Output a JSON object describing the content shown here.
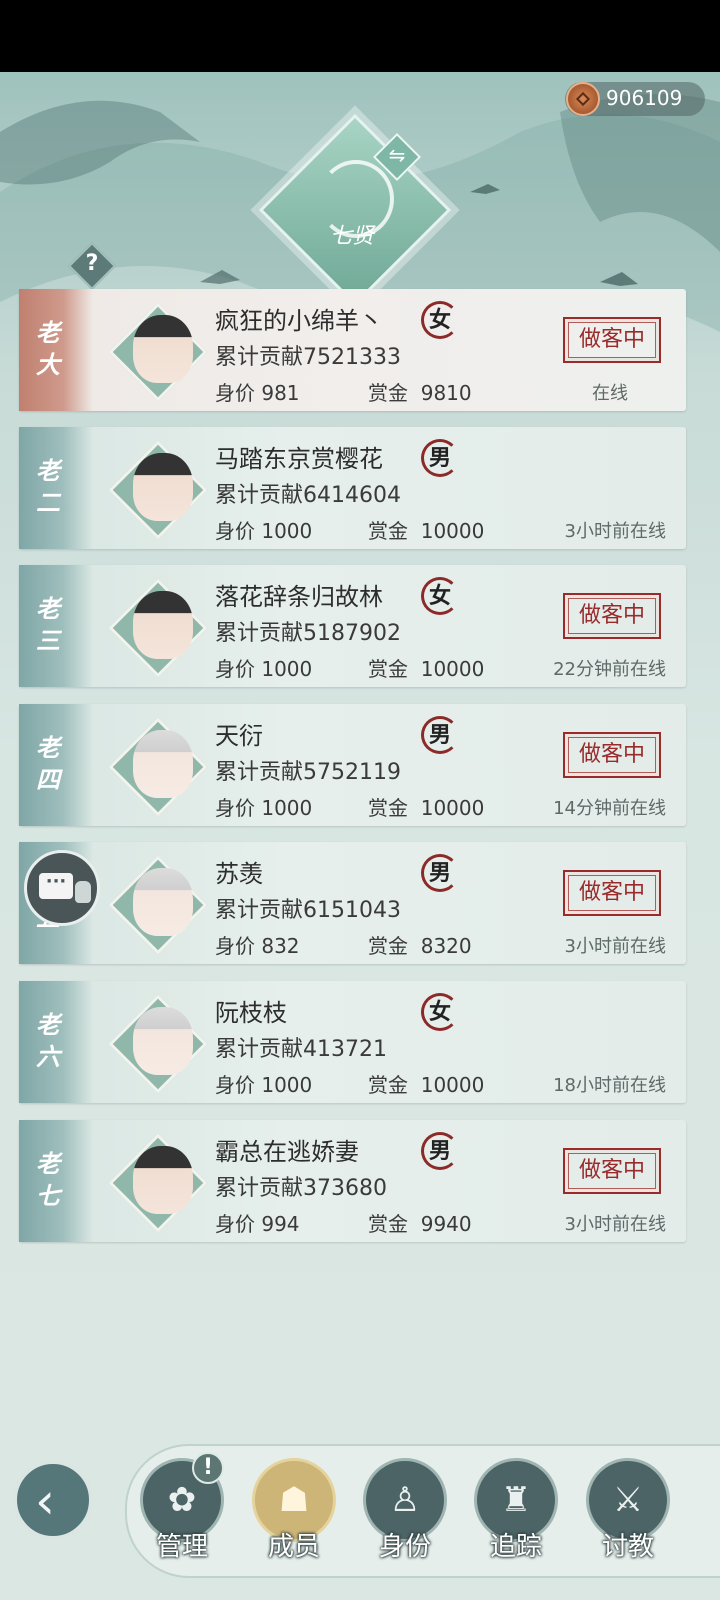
{
  "currency": {
    "value": "906109",
    "icon": "copper-coin-icon"
  },
  "emblem": {
    "title": "七贤"
  },
  "help": {
    "label": "?"
  },
  "swap": {
    "label": "⇋"
  },
  "members": [
    {
      "rank": "老大",
      "name": "疯狂的小绵羊丶",
      "gender": "女",
      "contribution_label": "累计贡献",
      "contribution": "7521333",
      "worth_label": "身价",
      "worth": "981",
      "bounty_label": "赏金",
      "bounty": "9810",
      "status": "做客中",
      "online": "在线"
    },
    {
      "rank": "老二",
      "name": "马踏东京赏樱花",
      "gender": "男",
      "contribution_label": "累计贡献",
      "contribution": "6414604",
      "worth_label": "身价",
      "worth": "1000",
      "bounty_label": "赏金",
      "bounty": "10000",
      "status": "",
      "online": "3小时前在线"
    },
    {
      "rank": "老三",
      "name": "落花辞条归故林",
      "gender": "女",
      "contribution_label": "累计贡献",
      "contribution": "5187902",
      "worth_label": "身价",
      "worth": "1000",
      "bounty_label": "赏金",
      "bounty": "10000",
      "status": "做客中",
      "online": "22分钟前在线"
    },
    {
      "rank": "老四",
      "name": "天衍",
      "gender": "男",
      "contribution_label": "累计贡献",
      "contribution": "5752119",
      "worth_label": "身价",
      "worth": "1000",
      "bounty_label": "赏金",
      "bounty": "10000",
      "status": "做客中",
      "online": "14分钟前在线"
    },
    {
      "rank": "老五",
      "name": "苏羡",
      "gender": "男",
      "contribution_label": "累计贡献",
      "contribution": "6151043",
      "worth_label": "身价",
      "worth": "832",
      "bounty_label": "赏金",
      "bounty": "8320",
      "status": "做客中",
      "online": "3小时前在线"
    },
    {
      "rank": "老六",
      "name": "阮枝枝",
      "gender": "女",
      "contribution_label": "累计贡献",
      "contribution": "413721",
      "worth_label": "身价",
      "worth": "1000",
      "bounty_label": "赏金",
      "bounty": "10000",
      "status": "",
      "online": "18小时前在线"
    },
    {
      "rank": "老七",
      "name": "霸总在逃娇妻",
      "gender": "男",
      "contribution_label": "累计贡献",
      "contribution": "373680",
      "worth_label": "身价",
      "worth": "994",
      "bounty_label": "赏金",
      "bounty": "9940",
      "status": "做客中",
      "online": "3小时前在线"
    }
  ],
  "nav": {
    "back_icon": "back-arrow-icon",
    "items": [
      {
        "label": "管理",
        "icon": "manage-icon",
        "glyph": "✿",
        "badge": "!"
      },
      {
        "label": "成员",
        "icon": "members-icon",
        "glyph": "☗",
        "active": true
      },
      {
        "label": "身份",
        "icon": "identity-card-icon",
        "glyph": "♙"
      },
      {
        "label": "追踪",
        "icon": "track-icon",
        "glyph": "♜"
      },
      {
        "label": "讨教",
        "icon": "duel-icon",
        "glyph": "⚔"
      }
    ]
  },
  "colors": {
    "accent_red": "#9a2b2b",
    "leader_rank": "#c0806f",
    "rank": "#7fa6a6",
    "nav_active": "#cdb477"
  }
}
